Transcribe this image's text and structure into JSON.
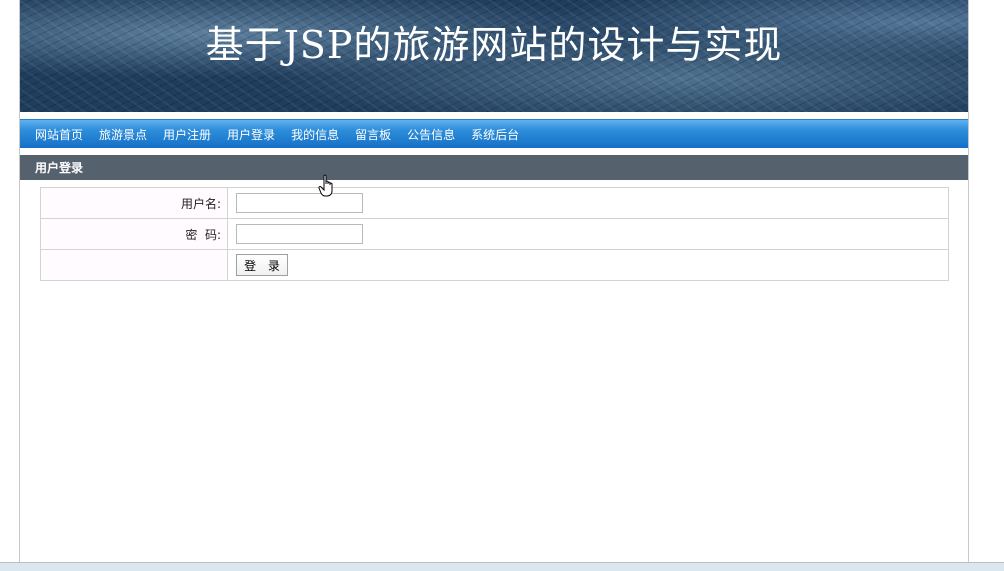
{
  "banner": {
    "title": "基于JSP的旅游网站的设计与实现"
  },
  "nav": {
    "items": [
      {
        "label": "网站首页"
      },
      {
        "label": "旅游景点"
      },
      {
        "label": "用户注册"
      },
      {
        "label": "用户登录"
      },
      {
        "label": "我的信息"
      },
      {
        "label": "留言板"
      },
      {
        "label": "公告信息"
      },
      {
        "label": "系统后台"
      }
    ]
  },
  "section": {
    "title": "用户登录"
  },
  "form": {
    "username_label": "用户名:",
    "username_value": "",
    "password_label": "密  码:",
    "password_value": "",
    "submit_label": "登 录"
  },
  "colors": {
    "nav_blue": "#2f8edb",
    "header_gray": "#55626e",
    "banner_dark": "#1f3d5c"
  }
}
